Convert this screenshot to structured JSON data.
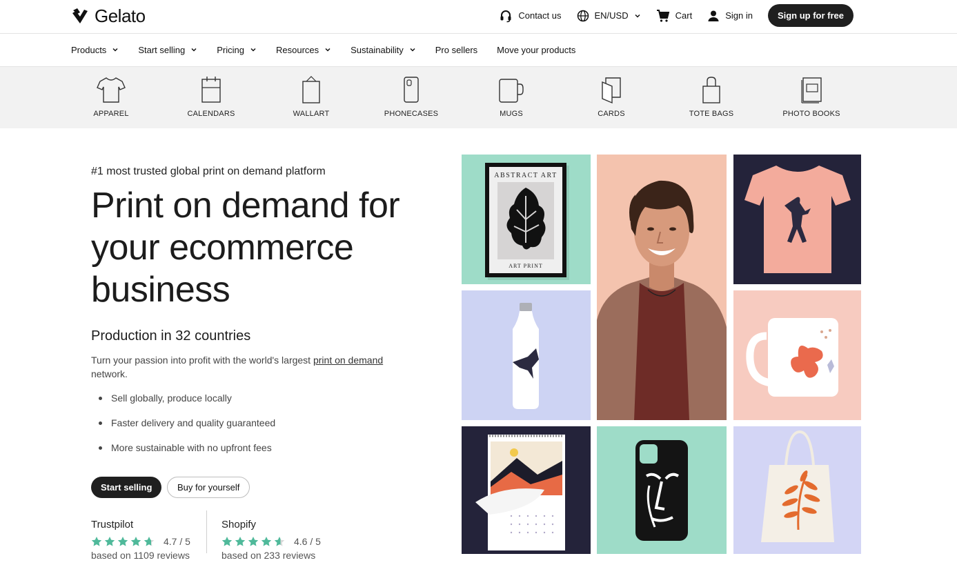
{
  "topbar": {
    "logo_text": "Gelato",
    "contact": "Contact us",
    "locale": "EN/USD",
    "cart": "Cart",
    "signin": "Sign in",
    "signup": "Sign up for free"
  },
  "nav": {
    "items": [
      {
        "label": "Products",
        "dropdown": true
      },
      {
        "label": "Start selling",
        "dropdown": true
      },
      {
        "label": "Pricing",
        "dropdown": true
      },
      {
        "label": "Resources",
        "dropdown": true
      },
      {
        "label": "Sustainability",
        "dropdown": true
      },
      {
        "label": "Pro sellers",
        "dropdown": false
      },
      {
        "label": "Move your products",
        "dropdown": false
      }
    ]
  },
  "categories": [
    {
      "label": "APPAREL",
      "icon": "tshirt-icon"
    },
    {
      "label": "CALENDARS",
      "icon": "calendar-icon"
    },
    {
      "label": "WALLART",
      "icon": "wallart-icon"
    },
    {
      "label": "PHONECASES",
      "icon": "phonecase-icon"
    },
    {
      "label": "MUGS",
      "icon": "mug-icon"
    },
    {
      "label": "CARDS",
      "icon": "cards-icon"
    },
    {
      "label": "TOTE BAGS",
      "icon": "totebag-icon"
    },
    {
      "label": "PHOTO BOOKS",
      "icon": "photobook-icon"
    }
  ],
  "hero": {
    "eyebrow": "#1 most trusted global print on demand platform",
    "headline": "Print on demand for your ecommerce business",
    "subhead": "Production in 32 countries",
    "desc_before": "Turn your passion into profit with the world's largest ",
    "desc_link": "print on demand",
    "desc_after": " network.",
    "bullets": [
      "Sell globally, produce locally",
      "Faster delivery and quality guaranteed",
      "More sustainable with no upfront fees"
    ],
    "cta_primary": "Start selling",
    "cta_secondary": "Buy for yourself"
  },
  "ratings": [
    {
      "name": "Trustpilot",
      "score": "4.7 / 5",
      "count": "based on 1109 reviews",
      "stars": 4.7
    },
    {
      "name": "Shopify",
      "score": "4.6 / 5",
      "count": "based on 233 reviews",
      "stars": 4.6
    }
  ],
  "gallery": {
    "art_print_top": "ABSTRACT ART",
    "art_print_bottom": "ART PRINT"
  },
  "colors": {
    "dark": "#1f1f1f",
    "star_green": "#4fb99a",
    "tile_mint": "#9edcc8",
    "tile_peach": "#f6c7b3",
    "tile_navy": "#24233a",
    "tile_lavender": "#cdd3f3",
    "tile_pink": "#f7cbc0",
    "tile_lilac": "#d3d5f5",
    "strip_gray": "#f2f2f2"
  }
}
